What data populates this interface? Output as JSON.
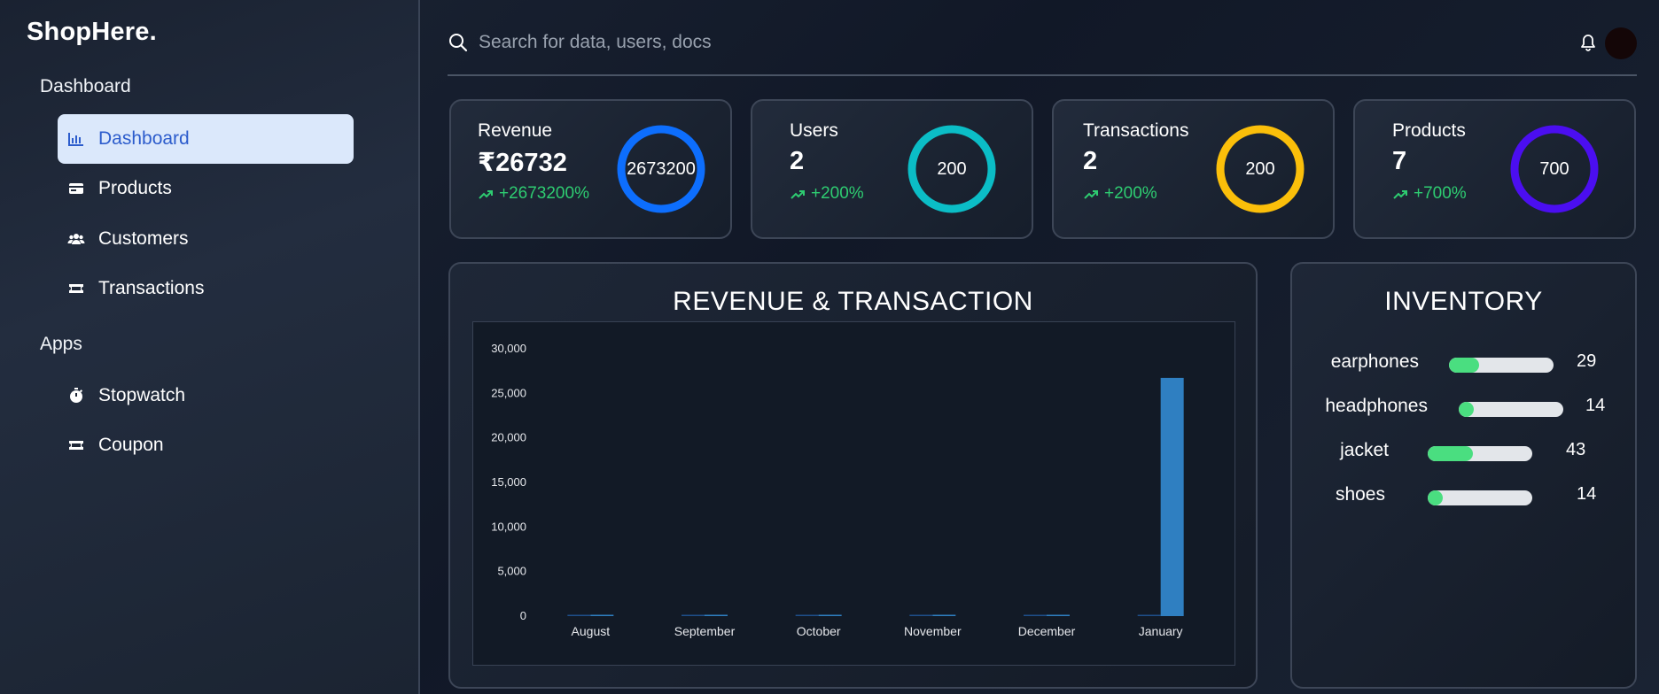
{
  "app": {
    "logo": "ShopHere."
  },
  "sidebar": {
    "sections": [
      {
        "title": "Dashboard"
      },
      {
        "title": "Apps"
      }
    ],
    "items": [
      {
        "label": "Dashboard",
        "icon": "bar-chart-icon",
        "active": true
      },
      {
        "label": "Products",
        "icon": "card-icon"
      },
      {
        "label": "Customers",
        "icon": "users-icon"
      },
      {
        "label": "Transactions",
        "icon": "ticket-icon"
      },
      {
        "label": "Stopwatch",
        "icon": "stopwatch-icon"
      },
      {
        "label": "Coupon",
        "icon": "ticket-icon"
      }
    ]
  },
  "topbar": {
    "search_placeholder": "Search for data, users, docs",
    "icons": [
      "search-icon",
      "bell-icon"
    ]
  },
  "stats": [
    {
      "label": "Revenue",
      "value": "₹26732",
      "change": "+2673200%",
      "ring_value": "2673200",
      "ring_color": "#0d6efd"
    },
    {
      "label": "Users",
      "value": "2",
      "change": "+200%",
      "ring_value": "200",
      "ring_color": "#0bbdc6"
    },
    {
      "label": "Transactions",
      "value": "2",
      "change": "+200%",
      "ring_value": "200",
      "ring_color": "#fbbf0a"
    },
    {
      "label": "Products",
      "value": "7",
      "change": "+700%",
      "ring_value": "700",
      "ring_color": "#4b0ef0"
    }
  ],
  "chart_panel": {
    "title": "REVENUE & TRANSACTION"
  },
  "chart_data": {
    "type": "bar",
    "categories": [
      "August",
      "September",
      "October",
      "November",
      "December",
      "January"
    ],
    "series": [
      {
        "values": [
          0,
          0,
          0,
          0,
          0,
          2
        ],
        "color": "#1e4f8a"
      },
      {
        "values": [
          0,
          0,
          0,
          0,
          0,
          26732
        ],
        "color": "#2f7fc1"
      }
    ],
    "ylim": [
      0,
      30000
    ],
    "yticks": [
      0,
      5000,
      10000,
      15000,
      20000,
      25000,
      30000
    ],
    "ytick_labels": [
      "0",
      "5,000",
      "10,000",
      "15,000",
      "20,000",
      "25,000",
      "30,000"
    ],
    "grid": false
  },
  "inventory": {
    "title": "INVENTORY",
    "items": [
      {
        "name": "earphones",
        "qty": "29",
        "percent": 29
      },
      {
        "name": "headphones",
        "qty": "14",
        "percent": 14
      },
      {
        "name": "jacket",
        "qty": "43",
        "percent": 43
      },
      {
        "name": "shoes",
        "qty": "14",
        "percent": 14
      }
    ]
  },
  "colors": {
    "accent": "#2c5ccc",
    "active_bg": "#dbe8fb",
    "positive": "#2ecc71"
  }
}
